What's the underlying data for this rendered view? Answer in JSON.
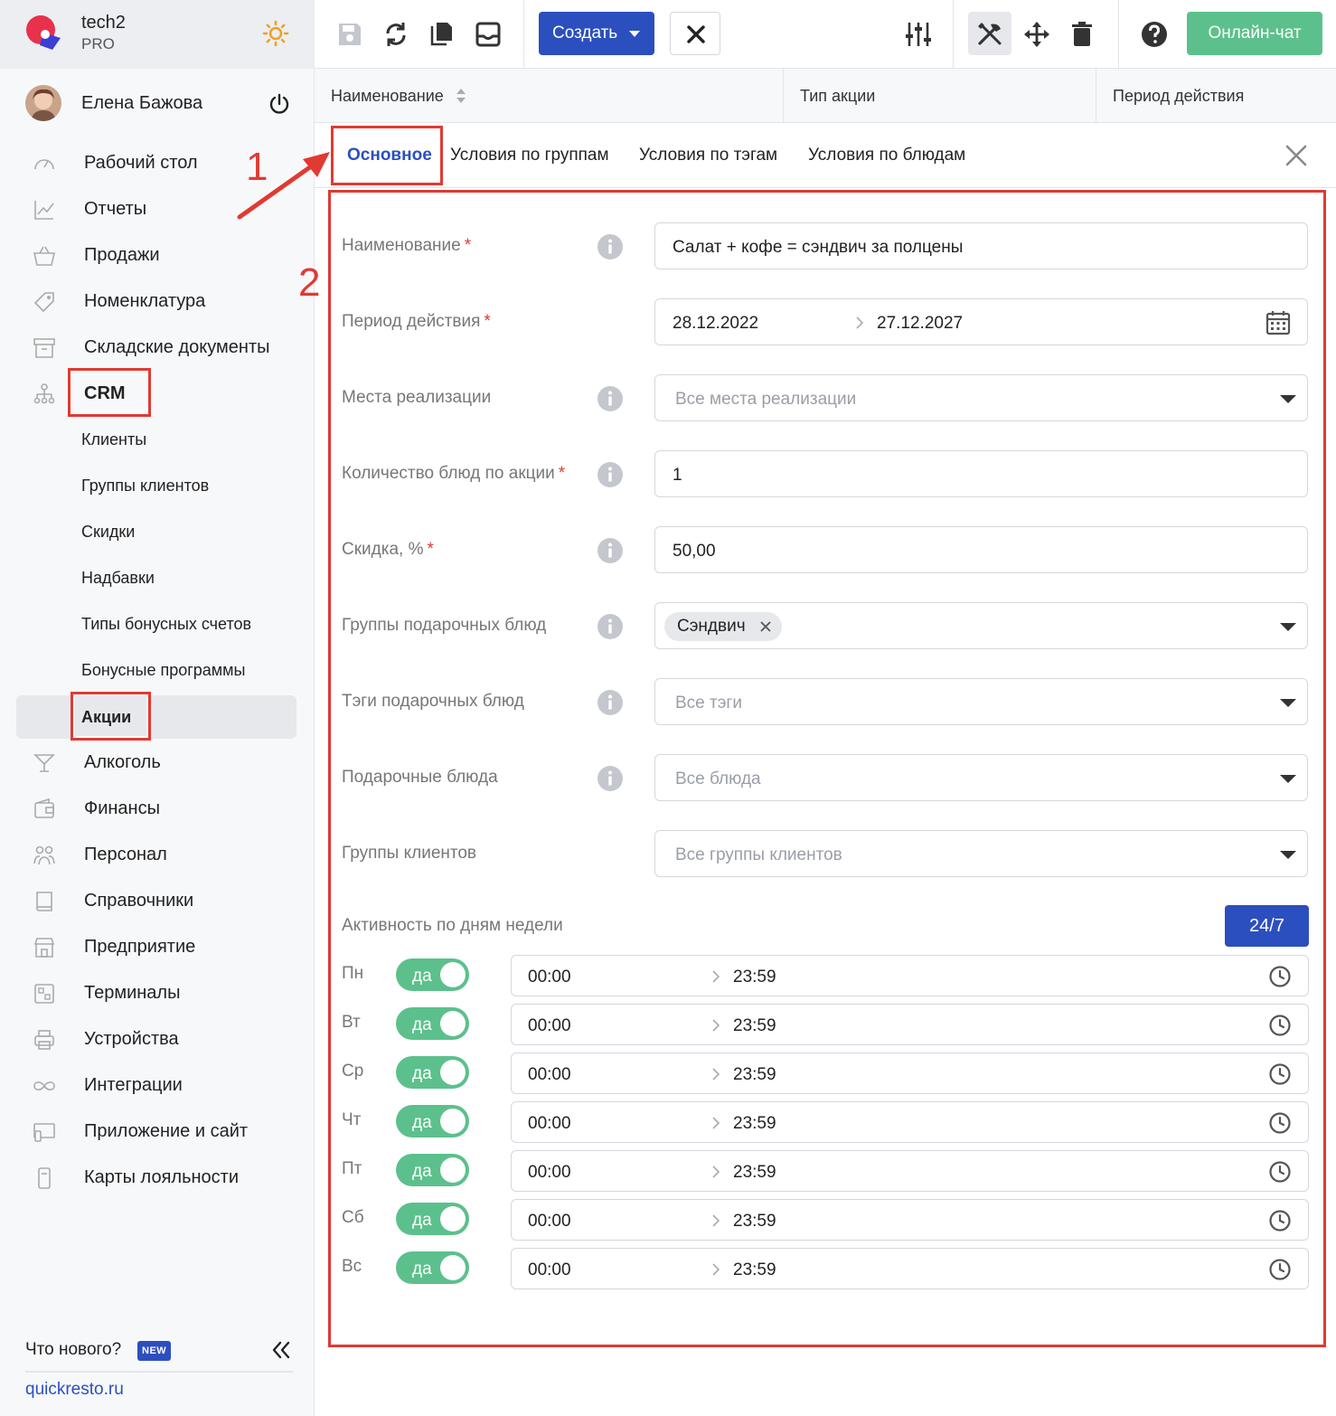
{
  "colors": {
    "accent": "#2c4fbf",
    "success": "#5cc08c",
    "annotation": "#e03a32"
  },
  "brand": {
    "name": "tech2",
    "plan": "PRO"
  },
  "user": {
    "name": "Елена Бажова"
  },
  "nav": {
    "items": [
      {
        "label": "Рабочий стол",
        "icon": "dashboard-icon"
      },
      {
        "label": "Отчеты",
        "icon": "chart-icon"
      },
      {
        "label": "Продажи",
        "icon": "basket-icon"
      },
      {
        "label": "Номенклатура",
        "icon": "tag-icon"
      },
      {
        "label": "Складские документы",
        "icon": "archive-icon"
      },
      {
        "label": "CRM",
        "icon": "org-chart-icon"
      }
    ],
    "crm_sub": [
      {
        "label": "Клиенты"
      },
      {
        "label": "Группы клиентов"
      },
      {
        "label": "Скидки"
      },
      {
        "label": "Надбавки"
      },
      {
        "label": "Типы бонусных счетов"
      },
      {
        "label": "Бонусные программы"
      },
      {
        "label": "Акции"
      }
    ],
    "items2": [
      {
        "label": "Алкоголь",
        "icon": "cocktail-icon"
      },
      {
        "label": "Финансы",
        "icon": "wallet-icon"
      },
      {
        "label": "Персонал",
        "icon": "people-icon"
      },
      {
        "label": "Справочники",
        "icon": "book-icon"
      },
      {
        "label": "Предприятие",
        "icon": "store-icon"
      },
      {
        "label": "Терминалы",
        "icon": "qr-icon"
      },
      {
        "label": "Устройства",
        "icon": "printer-icon"
      },
      {
        "label": "Интеграции",
        "icon": "infinity-icon"
      },
      {
        "label": "Приложение и сайт",
        "icon": "app-icon"
      },
      {
        "label": "Карты лояльности",
        "icon": "card-icon"
      }
    ]
  },
  "footer": {
    "whats_new": "Что нового?",
    "badge": "NEW",
    "site": "quickresto.ru"
  },
  "toolbar": {
    "create_label": "Создать",
    "chat_label": "Онлайн-чат"
  },
  "columns": [
    {
      "label": "Наименование"
    },
    {
      "label": "Тип акции"
    },
    {
      "label": "Период действия"
    }
  ],
  "tabs": [
    {
      "label": "Основное"
    },
    {
      "label": "Условия по группам"
    },
    {
      "label": "Условия по тэгам"
    },
    {
      "label": "Условия по блюдам"
    }
  ],
  "form": {
    "name": {
      "label": "Наименование",
      "value": "Салат + кофе = сэндвич за полцены"
    },
    "period": {
      "label": "Период действия",
      "from": "28.12.2022",
      "to": "27.12.2027"
    },
    "places": {
      "label": "Места реализации",
      "placeholder": "Все места реализации"
    },
    "qty": {
      "label": "Количество блюд по акции",
      "value": "1"
    },
    "discount": {
      "label": "Скидка, %",
      "value": "50,00"
    },
    "gift_groups": {
      "label": "Группы подарочных блюд",
      "chip": "Сэндвич"
    },
    "gift_tags": {
      "label": "Тэги подарочных блюд",
      "placeholder": "Все тэги"
    },
    "gift_dishes": {
      "label": "Подарочные блюда",
      "placeholder": "Все блюда"
    },
    "client_groups": {
      "label": "Группы клиентов",
      "placeholder": "Все группы клиентов"
    },
    "activity": {
      "label": "Активность по дням недели",
      "btn_247": "24/7"
    },
    "required_mark": "*"
  },
  "days": [
    {
      "label": "Пн",
      "toggle": "да",
      "from": "00:00",
      "to": "23:59"
    },
    {
      "label": "Вт",
      "toggle": "да",
      "from": "00:00",
      "to": "23:59"
    },
    {
      "label": "Ср",
      "toggle": "да",
      "from": "00:00",
      "to": "23:59"
    },
    {
      "label": "Чт",
      "toggle": "да",
      "from": "00:00",
      "to": "23:59"
    },
    {
      "label": "Пт",
      "toggle": "да",
      "from": "00:00",
      "to": "23:59"
    },
    {
      "label": "Сб",
      "toggle": "да",
      "from": "00:00",
      "to": "23:59"
    },
    {
      "label": "Вс",
      "toggle": "да",
      "from": "00:00",
      "to": "23:59"
    }
  ],
  "annotations": {
    "n1": "1",
    "n2": "2"
  }
}
